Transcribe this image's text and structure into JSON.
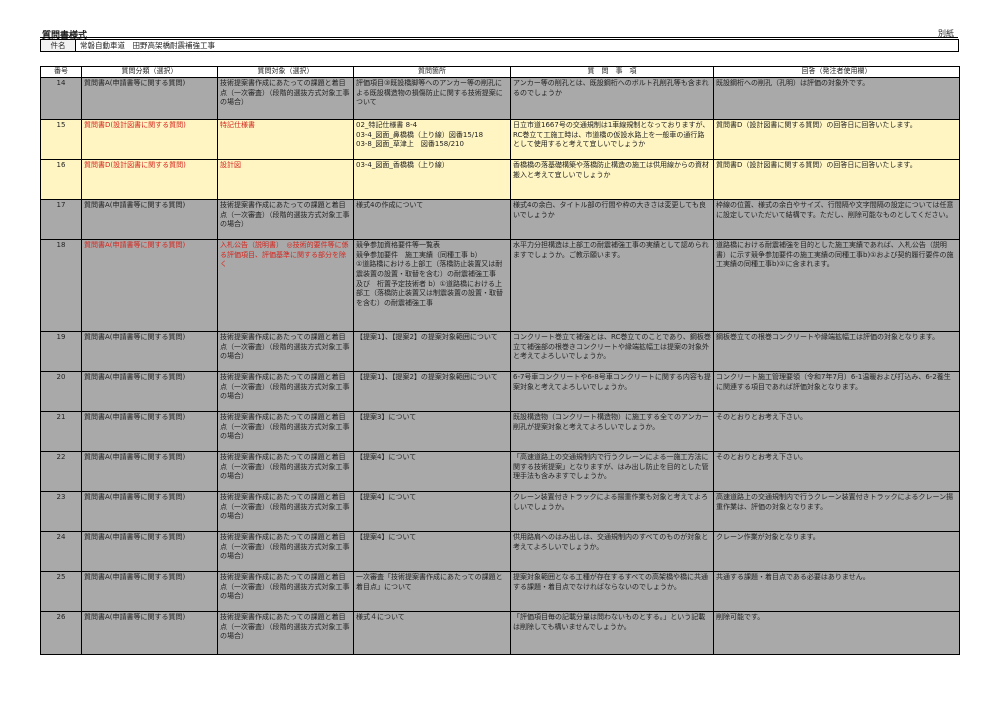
{
  "header": {
    "form_title": "質問書様式",
    "sheet_label": "別紙"
  },
  "case": {
    "label": "件名",
    "value": "常磐自動車道　田野高架橋耐震補強工事"
  },
  "columns": [
    "番号",
    "質問分類（選択）",
    "質問対象（選択）",
    "質問箇所",
    "質　問　事　項",
    "回答（発注者使用欄）"
  ],
  "rows": [
    {
      "no": "14",
      "category": "質問書A(申請書等に関する質問)",
      "target": "技術提案書作成にあたっての課題と着目点（一次審査）（段階的選抜方式対象工事の場合）",
      "location": "評価項目③既設橋脚等へのアンカー等の削孔による既設構造物の損傷防止に関する技術提案について",
      "question": "アンカー等の削孔とは、既設鋼桁へのボルト孔削孔等も含まれるのでしょうか",
      "answer": "既設鋼桁への削孔（孔明）は評価の対象外です。",
      "highlight": false,
      "red": false
    },
    {
      "no": "15",
      "category": "質問書D(設計図書に関する質問)",
      "target": "特記仕様書",
      "location": "02_特記仕様書 8-4\n03-4_図面_鼻橋橋（上り線）図番15/18\n03-8_図面_草津上　図番158/210",
      "question": "日立市道1667号の交通規制は1車線規制となっておりますが、RC巻立て工施工時は、市道橋の仮設水路上を一般車の通行路として使用すると考えて宜しいでしょうか",
      "answer": "質問書D（設計図書に関する質問）の回答日に回答いたします。",
      "highlight": true,
      "red": true
    },
    {
      "no": "16",
      "category": "質問書D(設計図書に関する質問)",
      "target": "設計図",
      "location": "03-4_図面_香橋橋（上り線）",
      "question": "香橋橋の落基礎構築や落橋防止構造の施工は供用線からの資材搬入と考えて宜しいでしょうか",
      "answer": "質問書D（設計図書に関する質問）の回答日に回答いたします。",
      "highlight": true,
      "red": true
    },
    {
      "no": "17",
      "category": "質問書A(申請書等に関する質問)",
      "target": "技術提案書作成にあたっての課題と着目点（一次審査）（段階的選抜方式対象工事の場合）",
      "location": "様式4の作成について",
      "question": "様式4の余白、タイトル部の行間や枠の大きさは変更しても良いでしょうか",
      "answer": "枠線の位置、様式の余白やサイズ、行間隔や文字間隔の設定については任意に設定していただいて結構です。ただし、削除可能なものとしてください。",
      "highlight": false,
      "red": false
    },
    {
      "no": "18",
      "category": "質問書A(申請書等に関する質問)",
      "target": "入札公告（説明書）　◎技術的要件等に係る評価項目、評価基準に関する部分を除く",
      "location": "競争参加資格要件等一覧表\n競争参加要件　施工実績（同種工事 b）\n①道路橋における上部工（落橋防止装置又は耐震装置の設置・取替を含む）の耐震補強工事　及び　桁置予定技術者 b）①道路橋における上部工（落橋防止装置又は制震装置の設置・取替を含む）の耐震補強工事",
      "question": "水平力分担構造は上部工の耐震補強工事の実績として認められますでしょうか。ご教示願います。",
      "answer": "道路橋における耐震補強を目的とした施工実績であれば、入札公告（説明書）に示す競争参加要件の施工実績の同種工事b)①および契約履行要件の施工実績の同種工事b)①に含まれます。",
      "highlight": false,
      "red": true
    },
    {
      "no": "19",
      "category": "質問書A(申請書等に関する質問)",
      "target": "技術提案書作成にあたっての課題と着目点（一次審査）（段階的選抜方式対象工事の場合）",
      "location": "【提案1】、【提案2】の提案対象範囲について",
      "question": "コンクリート巻立て補強とは、RC巻立てのことであり、鋼板巻立て補強部の根巻きコンクリートや縁端拡幅工は提案の対象外と考えてよろしいでしょうか。",
      "answer": "鋼板巻立ての根巻コンクリートや縁端拡幅工は評価の対象となります。",
      "highlight": false,
      "red": false
    },
    {
      "no": "20",
      "category": "質問書A(申請書等に関する質問)",
      "target": "技術提案書作成にあたっての課題と着目点（一次審査）（段階的選抜方式対象工事の場合）",
      "location": "【提案1】、【提案2】の提案対象範囲について",
      "question": "6-7号車コンクリートや6-8号車コンクリートに関する内容も提案対象と考えてよろしいでしょうか。",
      "answer": "コンクリート施工管理要領（令和7年7月）6-1温暖および打込み、6-2養生に関連する項目であれば評価対象となります。",
      "highlight": false,
      "red": false
    },
    {
      "no": "21",
      "category": "質問書A(申請書等に関する質問)",
      "target": "技術提案書作成にあたっての課題と着目点（一次審査）（段階的選抜方式対象工事の場合）",
      "location": "【提案3】について",
      "question": "既設構造物（コンクリート構造物）に施工する全てのアンカー削孔が提案対象と考えてよろしいでしょうか。",
      "answer": "そのとおりとお考え下さい。",
      "highlight": false,
      "red": false
    },
    {
      "no": "22",
      "category": "質問書A(申請書等に関する質問)",
      "target": "技術提案書作成にあたっての課題と着目点（一次審査）（段階的選抜方式対象工事の場合）",
      "location": "【提案4】について",
      "question": "「高速道路上の交通規制内で行うクレーンによる一施工方法に関する技術提案」となりますが、はみ出し防止を目的とした管理手法も含みますでしょうか。",
      "answer": "そのとおりとお考え下さい。",
      "highlight": false,
      "red": false
    },
    {
      "no": "23",
      "category": "質問書A(申請書等に関する質問)",
      "target": "技術提案書作成にあたっての課題と着目点（一次審査）（段階的選抜方式対象工事の場合）",
      "location": "【提案4】について",
      "question": "クレーン装置付きトラックによる揚重作業も対象と考えてよろしいでしょうか。",
      "answer": "高速道路上の交通規制内で行うクレーン装置付きトラックによるクレーン揚重作業は、評価の対象となります。",
      "highlight": false,
      "red": false
    },
    {
      "no": "24",
      "category": "質問書A(申請書等に関する質問)",
      "target": "技術提案書作成にあたっての課題と着目点（一次審査）（段階的選抜方式対象工事の場合）",
      "location": "【提案4】について",
      "question": "供用路肩へのはみ出しは、交通規制内のすべてのものが対象と考えてよろしいでしょうか。",
      "answer": "クレーン作業が対象となります。",
      "highlight": false,
      "red": false
    },
    {
      "no": "25",
      "category": "質問書A(申請書等に関する質問)",
      "target": "技術提案書作成にあたっての課題と着目点（一次審査）（段階的選抜方式対象工事の場合）",
      "location": "一次審査「技術提案書作成にあたっての課題と着目点」について",
      "question": "提案対象範囲となる工種が存在するすべての高架橋や橋に共通する課題・着目点でなければならないのでしょうか。",
      "answer": "共通する課題・着目点である必要はありません。",
      "highlight": false,
      "red": false
    },
    {
      "no": "26",
      "category": "質問書A(申請書等に関する質問)",
      "target": "技術提案書作成にあたっての課題と着目点（一次審査）（段階的選抜方式対象工事の場合）",
      "location": "様式４について",
      "question": "「評価項目毎の記載分量は問わないものとする。」という記載は削除しても構いませんでしょうか。",
      "answer": "削除可能です。",
      "highlight": false,
      "red": false
    }
  ],
  "colors": {
    "row_fill": "#a9a9a9",
    "highlight_fill": "#fff5c2",
    "red_text": "#d6261e"
  }
}
